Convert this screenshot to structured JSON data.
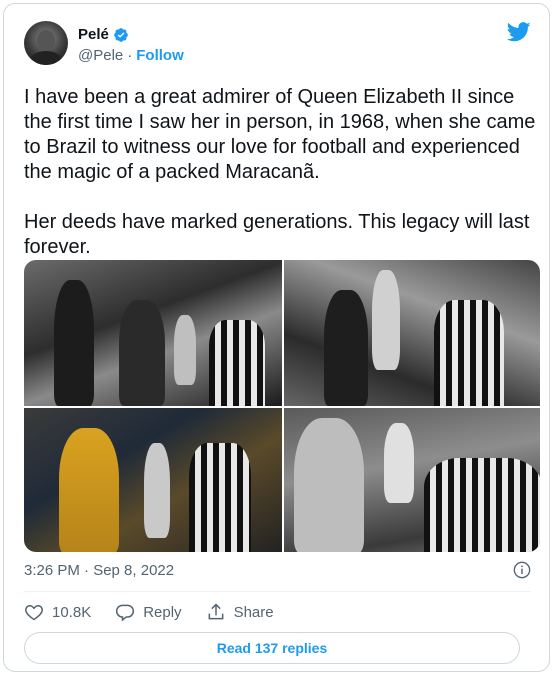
{
  "author": {
    "name": "Pelé",
    "handle": "@Pele",
    "separator": "·",
    "follow_label": "Follow",
    "verified_icon": "verified-badge-icon",
    "brand_color": "#1d9bf0"
  },
  "tweet": {
    "text": "I have been a great admirer of Queen Elizabeth II since the first time I saw her in person, in 1968, when she came to Brazil to witness our love for football and experienced the magic of a packed Maracanã.\n\nHer deeds have marked generations. This legacy will last forever.",
    "timestamp": "3:26 PM · Sep 8, 2022"
  },
  "media": {
    "count": 4,
    "style": "black-and-white and color photos"
  },
  "actions": {
    "like_count": "10.8K",
    "reply_label": "Reply",
    "share_label": "Share"
  },
  "replies": {
    "read_label": "Read 137 replies"
  }
}
